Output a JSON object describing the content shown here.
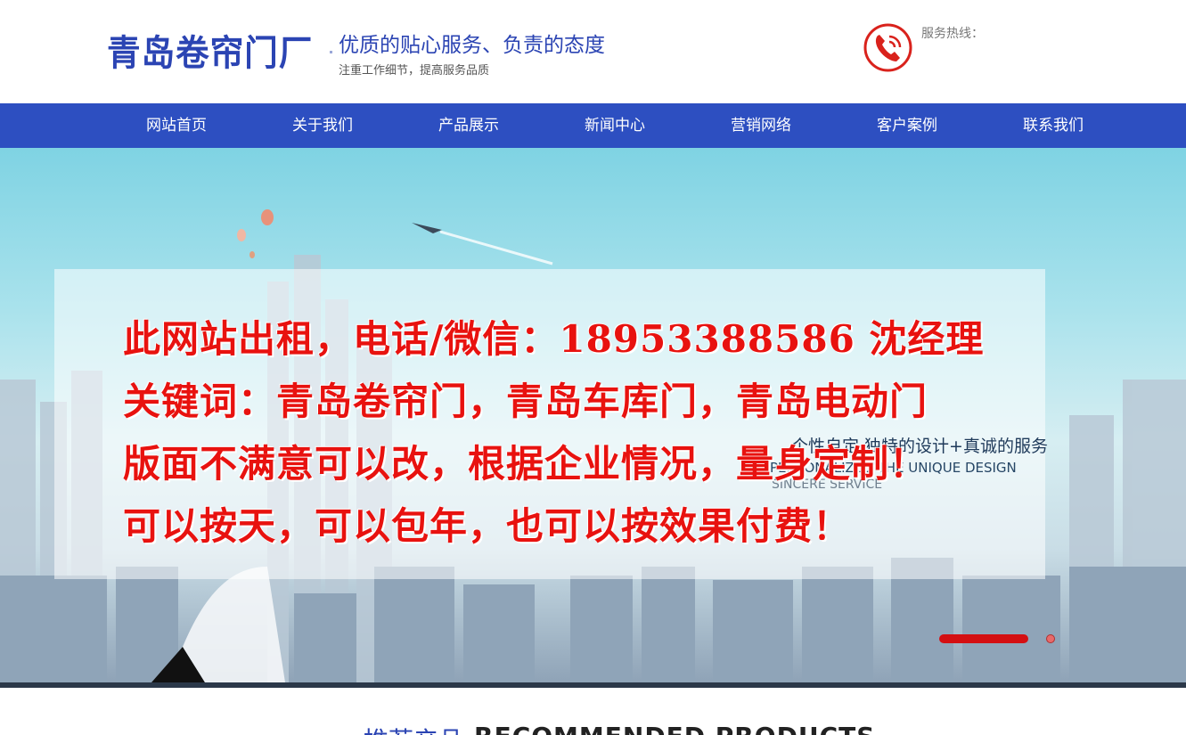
{
  "header": {
    "logo_text": "青岛卷帘门厂",
    "slogan": "优质的贴心服务、负责的态度",
    "sub_slogan": "注重工作细节，提高服务品质",
    "hotline_label": "服务热线：",
    "phone_icon": "phone-icon"
  },
  "nav": {
    "items": [
      {
        "label": "网站首页"
      },
      {
        "label": "关于我们"
      },
      {
        "label": "产品展示"
      },
      {
        "label": "新闻中心"
      },
      {
        "label": "营销网络"
      },
      {
        "label": "客户案例"
      },
      {
        "label": "联系我们"
      }
    ]
  },
  "banner": {
    "promo_lines": [
      "此网站出租，电话/微信：18953388586 沈经理",
      "关键词：青岛卷帘门，青岛车库门，青岛电动门",
      "版面不满意可以改，根据企业情况，量身定制！",
      "可以按天，可以包年，也可以按效果付费！"
    ],
    "right_cn": "个性自定  独特的设计+真诚的服务",
    "right_en": "PERSONALIZED    THE UNIQUE DESIGN",
    "right_en2": "SINCERE SERVICE",
    "slider": {
      "total": 2,
      "active": 1
    }
  },
  "section": {
    "title_cn": "推荐产品",
    "title_en": "RECOMMENDED PRODUCTS"
  },
  "colors": {
    "brand_blue": "#2d4fc1",
    "promo_red": "#e8120f",
    "phone_red": "#d9221c"
  }
}
